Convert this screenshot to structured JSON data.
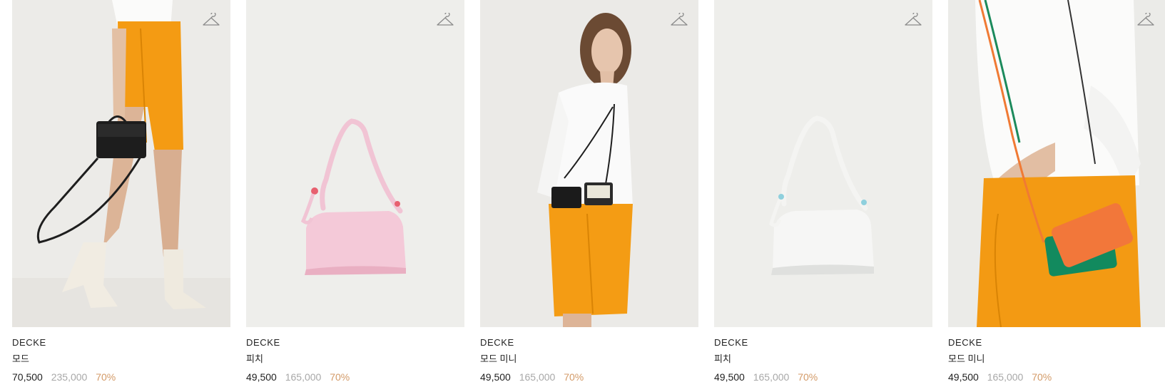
{
  "products": [
    {
      "brand": "DECKE",
      "name": "모드",
      "sale_price": "70,500",
      "original_price": "235,000",
      "discount": "70%",
      "wish_icon": "hanger-icon"
    },
    {
      "brand": "DECKE",
      "name": "피치",
      "sale_price": "49,500",
      "original_price": "165,000",
      "discount": "70%",
      "wish_icon": "hanger-icon"
    },
    {
      "brand": "DECKE",
      "name": "모드 미니",
      "sale_price": "49,500",
      "original_price": "165,000",
      "discount": "70%",
      "wish_icon": "hanger-icon"
    },
    {
      "brand": "DECKE",
      "name": "피치",
      "sale_price": "49,500",
      "original_price": "165,000",
      "discount": "70%",
      "wish_icon": "hanger-icon"
    },
    {
      "brand": "DECKE",
      "name": "모드 미니",
      "sale_price": "49,500",
      "original_price": "165,000",
      "discount": "70%",
      "wish_icon": "hanger-icon"
    }
  ],
  "colors": {
    "discount": "#d39a67",
    "original_price": "#a8a8a8",
    "text": "#222222",
    "photo_bg": "#eeeeeb"
  }
}
